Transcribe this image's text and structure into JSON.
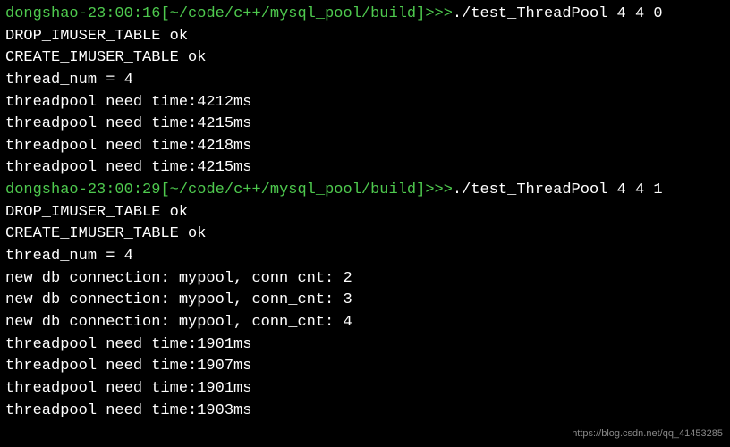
{
  "lines": [
    {
      "type": "prompt",
      "user": "dongshao",
      "time": "23:00:16",
      "path": "~/code/c++/mysql_pool/build",
      "marker": ">>>",
      "command": "./test_ThreadPool 4 4 0"
    },
    {
      "type": "output",
      "text": "DROP_IMUSER_TABLE ok"
    },
    {
      "type": "output",
      "text": "CREATE_IMUSER_TABLE ok"
    },
    {
      "type": "output",
      "text": "thread_num = 4"
    },
    {
      "type": "output",
      "text": "threadpool need time:4212ms"
    },
    {
      "type": "output",
      "text": "threadpool need time:4215ms"
    },
    {
      "type": "output",
      "text": "threadpool need time:4218ms"
    },
    {
      "type": "output",
      "text": "threadpool need time:4215ms"
    },
    {
      "type": "prompt",
      "user": "dongshao",
      "time": "23:00:29",
      "path": "~/code/c++/mysql_pool/build",
      "marker": ">>>",
      "command": "./test_ThreadPool 4 4 1"
    },
    {
      "type": "output",
      "text": "DROP_IMUSER_TABLE ok"
    },
    {
      "type": "output",
      "text": "CREATE_IMUSER_TABLE ok"
    },
    {
      "type": "output",
      "text": "thread_num = 4"
    },
    {
      "type": "output",
      "text": "new db connection: mypool, conn_cnt: 2"
    },
    {
      "type": "output",
      "text": "new db connection: mypool, conn_cnt: 3"
    },
    {
      "type": "output",
      "text": "new db connection: mypool, conn_cnt: 4"
    },
    {
      "type": "output",
      "text": "threadpool need time:1901ms"
    },
    {
      "type": "output",
      "text": "threadpool need time:1907ms"
    },
    {
      "type": "output",
      "text": "threadpool need time:1901ms"
    },
    {
      "type": "output",
      "text": "threadpool need time:1903ms"
    }
  ],
  "watermark": "https://blog.csdn.net/qq_41453285"
}
